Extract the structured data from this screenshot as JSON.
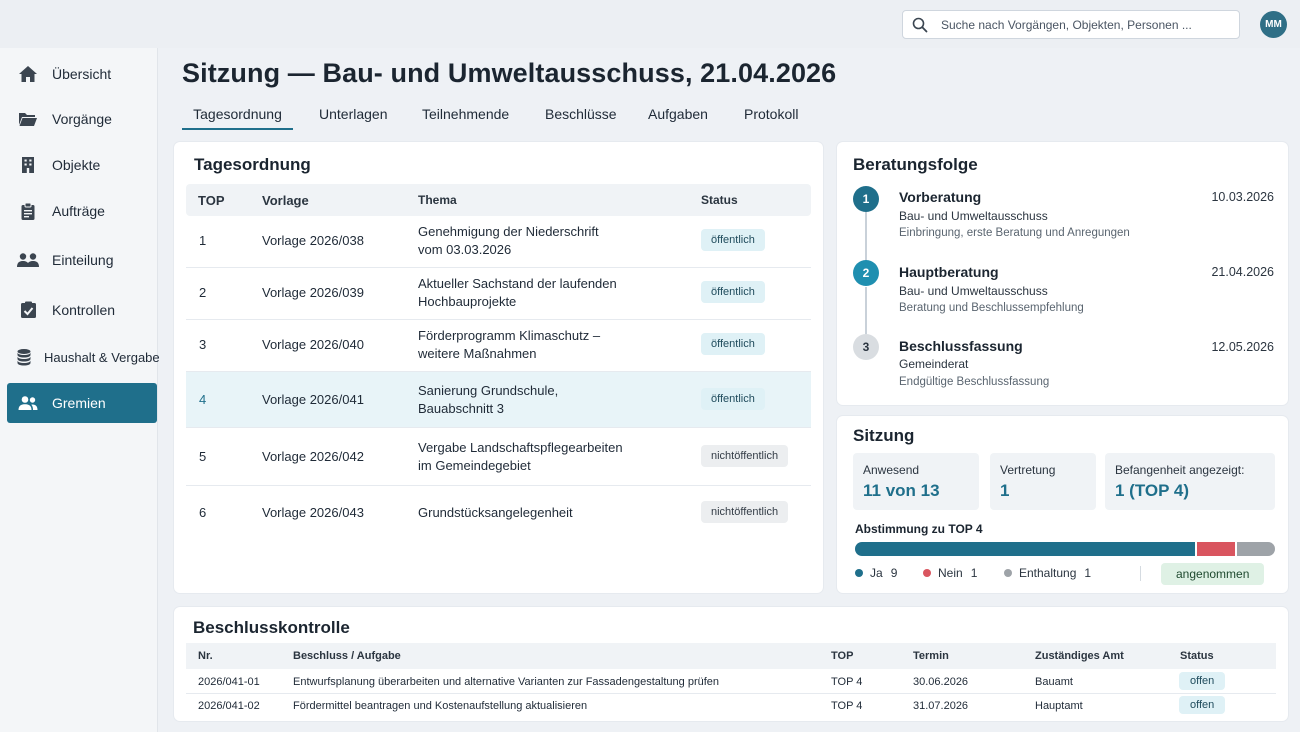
{
  "search": {
    "placeholder": "Suche nach Vorgängen, Objekten, Personen ..."
  },
  "user": {
    "initials": "MM"
  },
  "sidebar": {
    "items": [
      {
        "label": "Übersicht",
        "icon": "home-icon"
      },
      {
        "label": "Vorgänge",
        "icon": "folder-icon"
      },
      {
        "label": "Objekte",
        "icon": "building-icon"
      },
      {
        "label": "Aufträge",
        "icon": "clipboard-icon"
      },
      {
        "label": "Einteilung",
        "icon": "people-icon"
      },
      {
        "label": "Kontrollen",
        "icon": "checkbox-icon"
      },
      {
        "label": "Haushalt & Vergabe",
        "icon": "coins-icon"
      },
      {
        "label": "Gremien",
        "icon": "group-icon",
        "active": true
      }
    ]
  },
  "page": {
    "title": "Sitzung — Bau- und Umweltausschuss, 21.04.2026"
  },
  "tabs": [
    "Tagesordnung",
    "Unterlagen",
    "Teilnehmende",
    "Beschlüsse",
    "Aufgaben",
    "Protokoll"
  ],
  "agenda": {
    "title": "Tagesordnung",
    "headers": {
      "top": "TOP",
      "vorlage": "Vorlage",
      "thema": "Thema",
      "status": "Status"
    },
    "rows": [
      {
        "top": "1",
        "vorlage": "Vorlage 2026/038",
        "thema1": "Genehmigung der Niederschrift",
        "thema2": "vom 03.03.2026",
        "status": "öffentlich"
      },
      {
        "top": "2",
        "vorlage": "Vorlage 2026/039",
        "thema1": "Aktueller Sachstand der laufenden",
        "thema2": "Hochbauprojekte",
        "status": "öffentlich"
      },
      {
        "top": "3",
        "vorlage": "Vorlage 2026/040",
        "thema1": "Förderprogramm Klimaschutz –",
        "thema2": "weitere Maßnahmen",
        "status": "öffentlich"
      },
      {
        "top": "4",
        "vorlage": "Vorlage 2026/041",
        "thema1": "Sanierung Grundschule,",
        "thema2": "Bauabschnitt 3",
        "status": "öffentlich"
      },
      {
        "top": "5",
        "vorlage": "Vorlage 2026/042",
        "thema1": "Vergabe Landschaftspflegearbeiten",
        "thema2": "im Gemeindegebiet",
        "status": "nichtöffentlich"
      },
      {
        "top": "6",
        "vorlage": "Vorlage 2026/043",
        "thema1": "Grundstücksangelegenheit",
        "thema2": "",
        "status": "nichtöffentlich"
      }
    ]
  },
  "beratungsfolge": {
    "title": "Beratungsfolge",
    "steps": [
      {
        "num": "1",
        "title": "Vorberatung",
        "gremium": "Bau- und Umweltausschuss",
        "desc": "Einbringung, erste Beratung und Anregungen",
        "date": "10.03.2026"
      },
      {
        "num": "2",
        "title": "Hauptberatung",
        "gremium": "Bau- und Umweltausschuss",
        "desc": "Beratung und Beschlussempfehlung",
        "date": "21.04.2026"
      },
      {
        "num": "3",
        "title": "Beschlussfassung",
        "gremium": "Gemeinderat",
        "desc": "Endgültige Beschlussfassung",
        "date": "12.05.2026"
      }
    ]
  },
  "sitzung": {
    "title": "Sitzung",
    "anwesend_label": "Anwesend",
    "anwesend_value": "11 von 13",
    "vertretung_label": "Vertretung",
    "vertretung_value": "1",
    "befangenheit_label": "Befangenheit angezeigt:",
    "befangenheit_value": "1 (TOP 4)",
    "vote_title": "Abstimmung zu TOP 4",
    "votes": {
      "ja_label": "Ja",
      "ja": 9,
      "nein_label": "Nein",
      "nein": 1,
      "enthaltung_label": "Enthaltung",
      "enthaltung": 1
    },
    "result": "angenommen"
  },
  "beschlusskontrolle": {
    "title": "Beschlusskontrolle",
    "headers": {
      "nr": "Nr.",
      "beschluss": "Beschluss / Aufgabe",
      "top": "TOP",
      "termin": "Termin",
      "amt": "Zuständiges Amt",
      "status": "Status"
    },
    "rows": [
      {
        "nr": "2026/041-01",
        "beschluss": "Entwurfsplanung überarbeiten und alternative Varianten zur Fassadengestaltung prüfen",
        "top": "TOP 4",
        "termin": "30.06.2026",
        "amt": "Bauamt",
        "status": "offen"
      },
      {
        "nr": "2026/041-02",
        "beschluss": "Fördermittel beantragen und Kostenaufstellung aktualisieren",
        "top": "TOP 4",
        "termin": "31.07.2026",
        "amt": "Hauptamt",
        "status": "offen"
      }
    ]
  },
  "colors": {
    "accent": "#1f6f8b",
    "ja": "#1f6f8b",
    "nein": "#d9555f",
    "enthaltung": "#9ea3a8",
    "step_active": "#1f8fb0",
    "step_done": "#1f6f8b"
  }
}
